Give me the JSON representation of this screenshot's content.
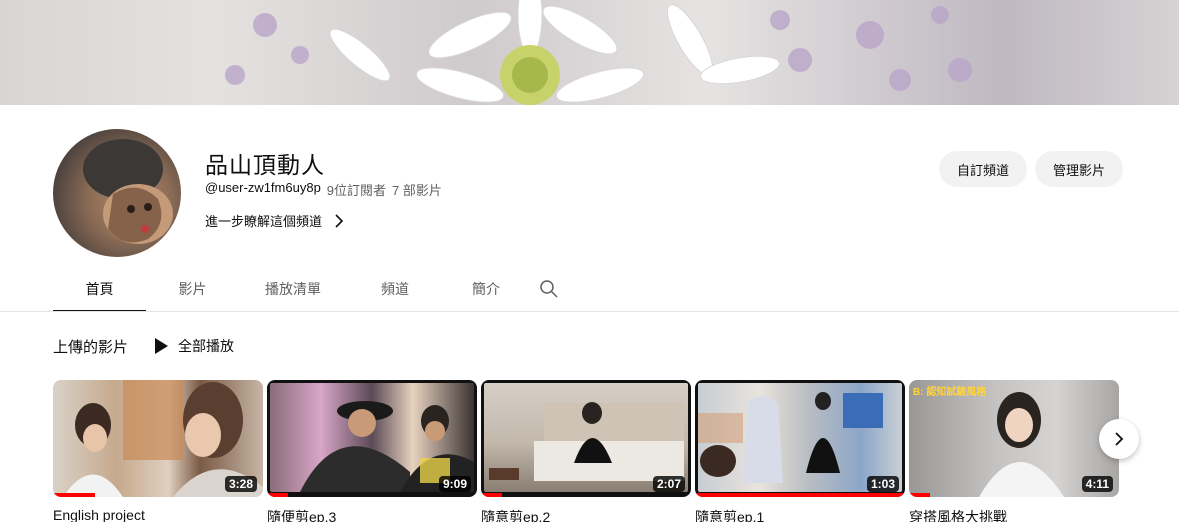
{
  "channel": {
    "name": "品山頂動人",
    "handle": "@user-zw1fm6uy8p",
    "subscribers": "9位訂閱者",
    "videos_count": "7 部影片",
    "more_about": "進一步瞭解這個頻道"
  },
  "actions": {
    "customize": "自訂頻道",
    "manage": "管理影片"
  },
  "tabs": [
    {
      "label": "首頁",
      "active": true
    },
    {
      "label": "影片",
      "active": false
    },
    {
      "label": "播放清單",
      "active": false
    },
    {
      "label": "頻道",
      "active": false
    },
    {
      "label": "簡介",
      "active": false
    }
  ],
  "section": {
    "title": "上傳的影片",
    "play_all": "全部播放"
  },
  "videos": [
    {
      "title": "English project",
      "duration": "3:28",
      "progress": 0.2
    },
    {
      "title": "隨便剪ep.3",
      "duration": "9:09",
      "progress": 0.1
    },
    {
      "title": "隨意剪ep.2",
      "duration": "2:07",
      "progress": 0.1
    },
    {
      "title": "隨意剪ep.1",
      "duration": "1:03",
      "progress": 1.0
    },
    {
      "title": "穿搭風格大挑戰",
      "duration": "4:11",
      "progress": 0.1
    }
  ],
  "thumb_overlays": {
    "video5_caption": "B: 認知試驗風格"
  },
  "colors": {
    "progress": "#ff0000",
    "pill_bg": "#f2f2f2",
    "text_secondary": "#606060"
  },
  "icons": [
    "search-icon",
    "chevron-right-icon",
    "play-icon",
    "next-arrow-icon"
  ]
}
